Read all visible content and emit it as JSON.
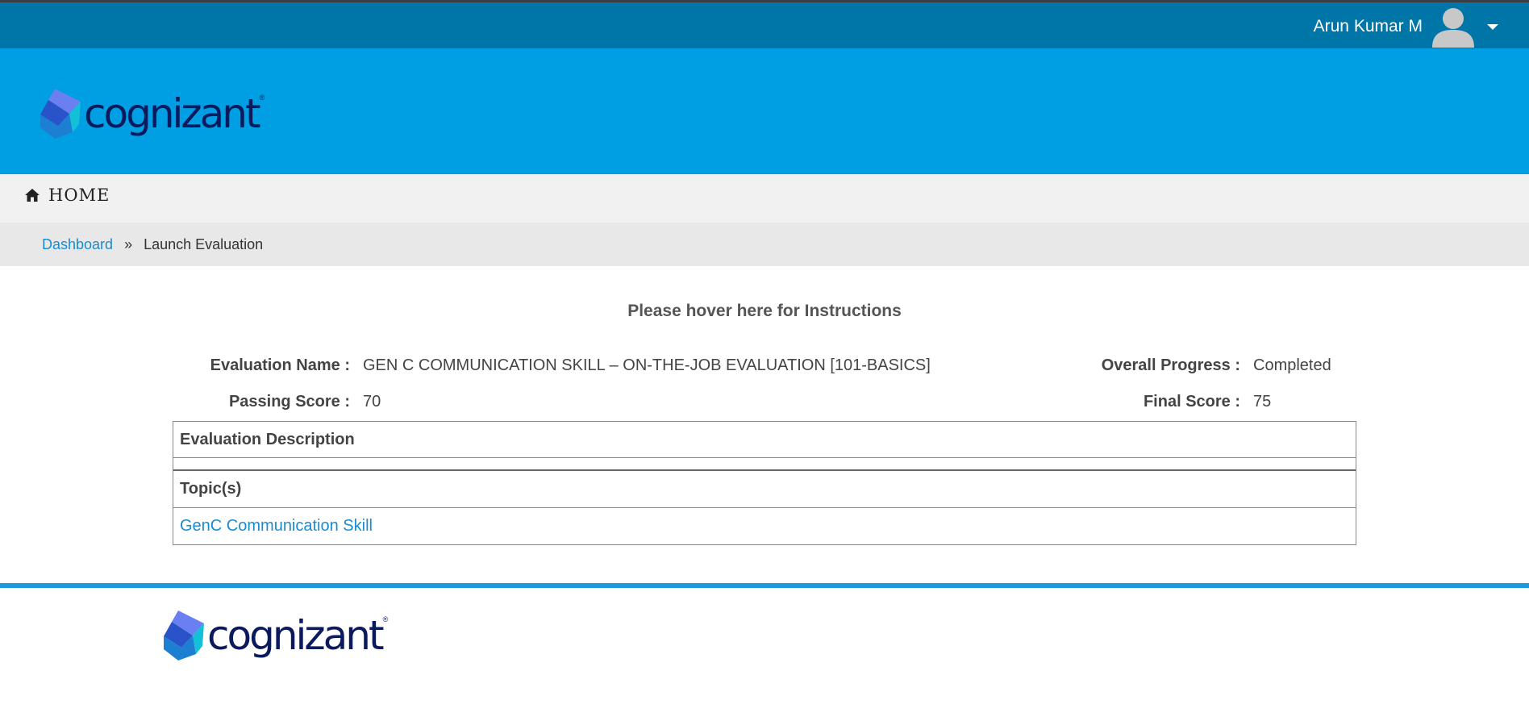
{
  "header": {
    "user_name": "Arun Kumar M",
    "icons": {
      "avatar": "user-avatar-icon",
      "dropdown": "caret-down-icon"
    }
  },
  "brand": {
    "logo_text": "cognizant",
    "logo_mark": "®"
  },
  "nav": {
    "home_label": "HOME",
    "home_icon": "home-icon"
  },
  "breadcrumb": {
    "items": [
      "Dashboard",
      "Launch Evaluation"
    ],
    "separator": "»"
  },
  "main": {
    "instructions": "Please hover here for Instructions",
    "evaluation_name_label": "Evaluation Name :",
    "evaluation_name_value": "GEN C COMMUNICATION SKILL – ON-THE-JOB EVALUATION [101-BASICS]",
    "overall_progress_label": "Overall Progress :",
    "overall_progress_value": "Completed",
    "passing_score_label": "Passing Score :",
    "passing_score_value": "70",
    "final_score_label": "Final Score :",
    "final_score_value": "75",
    "description_header": "Evaluation Description",
    "description_text": "",
    "topics_header": "Topic(s)",
    "topics": [
      "GenC Communication Skill"
    ]
  },
  "footer": {
    "logo_text": "cognizant",
    "logo_mark": "®"
  },
  "colors": {
    "topbar": "#0075a8",
    "brand_bar": "#009ee3",
    "link": "#1a8bd1",
    "footer_line": "#1a9be0",
    "logo_text": "#0a1a5c"
  }
}
